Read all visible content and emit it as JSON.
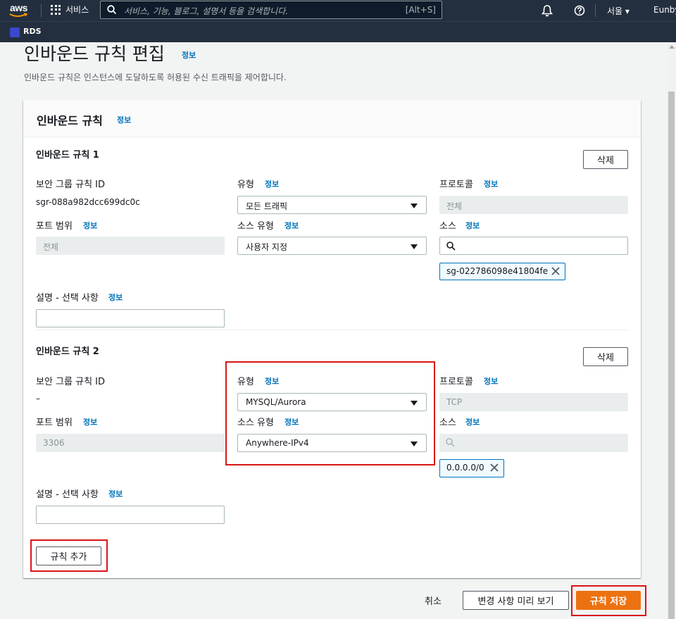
{
  "nav": {
    "logo_text": "aws",
    "services_label": "서비스",
    "search_placeholder": "서비스, 기능, 블로그, 설명서 등을 검색합니다.",
    "search_shortcut": "[Alt+S]",
    "region_label": "서울 ▾",
    "user_label": "Eunbye"
  },
  "subnav": {
    "service_label": "RDS"
  },
  "page": {
    "title": "인바운드 규칙 편집",
    "title_info": "정보",
    "description": "인바운드 규칙은 인스턴스에 도달하도록 허용된 수신 트래픽을 제어합니다."
  },
  "panel": {
    "title": "인바운드 규칙",
    "info": "정보"
  },
  "labels": {
    "sg_rule_id": "보안 그룹 규칙 ID",
    "type": "유형",
    "protocol": "프로토콜",
    "port_range": "포트 범위",
    "source_type": "소스 유형",
    "source": "소스",
    "description": "설명 - 선택 사항",
    "info": "정보",
    "delete": "삭제"
  },
  "rules": [
    {
      "title": "인바운드 규칙 1",
      "sg_rule_id": "sgr-088a982dcc699dc0c",
      "type": "모든 트래픽",
      "protocol": "전체",
      "port_range": "전체",
      "source_type": "사용자 지정",
      "source_search": "",
      "source_token": "sg-022786098e41804fe",
      "description": ""
    },
    {
      "title": "인바운드 규칙 2",
      "sg_rule_id": "–",
      "type": "MYSQL/Aurora",
      "protocol": "TCP",
      "port_range": "3306",
      "source_type": "Anywhere-IPv4",
      "source_search": "",
      "source_token": "0.0.0.0/0",
      "description": ""
    }
  ],
  "add_rule_label": "규칙 추가",
  "footer": {
    "cancel_label": "취소",
    "preview_label": "변경 사항 미리 보기",
    "save_label": "규칙 저장"
  },
  "colors": {
    "nav_bg": "#232f3e",
    "primary": "#ec7211",
    "info_link": "#0073bb",
    "highlight": "#d91515"
  }
}
